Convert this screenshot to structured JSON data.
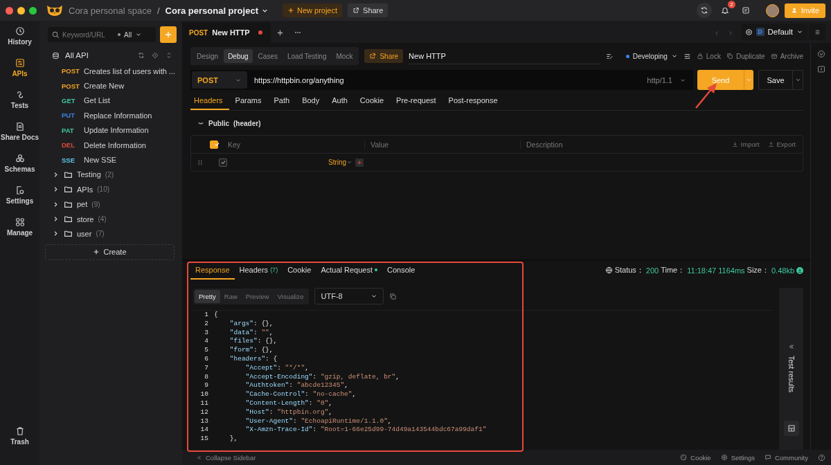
{
  "topbar": {
    "workspace": "Cora personal space",
    "separator": "/",
    "project": "Cora personal project",
    "new_project": "New project",
    "share": "Share",
    "notifications": "2",
    "invite": "Invite"
  },
  "rail": [
    {
      "label": "History",
      "selected": false
    },
    {
      "label": "APIs",
      "selected": true
    },
    {
      "label": "Tests",
      "selected": false
    },
    {
      "label": "Share Docs",
      "selected": false
    },
    {
      "label": "Schemas",
      "selected": false
    },
    {
      "label": "Settings",
      "selected": false
    },
    {
      "label": "Manage",
      "selected": false
    }
  ],
  "rail_bottom": "Trash",
  "sidebar": {
    "search_placeholder": "Keyword/URL",
    "filter": "All",
    "root": "All API",
    "apis": [
      {
        "method": "POST",
        "name": "Creates list of users with ...",
        "color": "#f5a623"
      },
      {
        "method": "POST",
        "name": "Create New",
        "color": "#f5a623"
      },
      {
        "method": "GET",
        "name": "Get List",
        "color": "#3ec9a0"
      },
      {
        "method": "PUT",
        "name": "Replace Information",
        "color": "#3a82e8"
      },
      {
        "method": "PAT",
        "name": "Update Information",
        "color": "#3ec9a0"
      },
      {
        "method": "DEL",
        "name": "Delete Information",
        "color": "#e5493a"
      },
      {
        "method": "SSE",
        "name": "New SSE",
        "color": "#5ec8e8"
      }
    ],
    "folders": [
      {
        "name": "Testing",
        "count": "(2)",
        "expanded": false
      },
      {
        "name": "APIs",
        "count": "(10)",
        "expanded": false
      },
      {
        "name": "pet",
        "count": "(9)",
        "expanded": false
      },
      {
        "name": "store",
        "count": "(4)",
        "expanded": false
      },
      {
        "name": "user",
        "count": "(7)",
        "expanded": false
      }
    ],
    "create": "Create"
  },
  "tab": {
    "method": "POST",
    "name": "New HTTP",
    "unsaved": true
  },
  "environment": {
    "badge": "D",
    "name": "Default"
  },
  "modes": [
    {
      "label": "Design",
      "selected": false
    },
    {
      "label": "Debug",
      "selected": true
    },
    {
      "label": "Cases",
      "selected": false
    },
    {
      "label": "Load Testing",
      "selected": false
    },
    {
      "label": "Mock",
      "selected": false
    }
  ],
  "api_share": "Share",
  "api_name": "New HTTP",
  "api_status": "Developing",
  "api_actions": [
    "Lock",
    "Duplicate",
    "Archive"
  ],
  "request": {
    "method": "POST",
    "url": "https://httpbin.org/anything",
    "protocol": "http/1.1",
    "send": "Send",
    "save": "Save"
  },
  "request_tabs": [
    {
      "label": "Headers",
      "selected": true
    },
    {
      "label": "Params",
      "selected": false
    },
    {
      "label": "Path",
      "selected": false
    },
    {
      "label": "Body",
      "selected": false
    },
    {
      "label": "Auth",
      "selected": false
    },
    {
      "label": "Cookie",
      "selected": false
    },
    {
      "label": "Pre-request",
      "selected": false
    },
    {
      "label": "Post-response",
      "selected": false
    }
  ],
  "public_group": {
    "label": "Public",
    "note": "(header)",
    "expanded": true
  },
  "params_table": {
    "columns": [
      "Key",
      "Value",
      "Description"
    ],
    "all_checked": true,
    "import": "Import",
    "export": "Export",
    "rows": [
      {
        "checked": true,
        "type": "String",
        "required": true
      }
    ]
  },
  "response_tabs": [
    {
      "label": "Response",
      "dot": false,
      "selected": true
    },
    {
      "label": "Headers",
      "count": "(7)",
      "dot": false,
      "selected": false
    },
    {
      "label": "Cookie",
      "dot": false,
      "selected": false
    },
    {
      "label": "Actual Request",
      "dot": true,
      "selected": false
    },
    {
      "label": "Console",
      "dot": false,
      "selected": false
    }
  ],
  "response_meta": {
    "status_label": "Status：",
    "status": "200",
    "time_label": "Time：",
    "time": "11:18:47",
    "duration": "1164ms",
    "size_label": "Size：",
    "size": "0.48kb"
  },
  "view_modes": [
    {
      "label": "Pretty",
      "selected": true
    },
    {
      "label": "Raw",
      "selected": false
    },
    {
      "label": "Preview",
      "selected": false
    },
    {
      "label": "Visualize",
      "selected": false
    }
  ],
  "encoding": "UTF-8",
  "code_lines": [
    {
      "number": "1",
      "tokens": [
        {
          "kind": "punct",
          "text": "{"
        }
      ]
    },
    {
      "number": "2",
      "tokens": [
        {
          "kind": "key",
          "text": "\"args\""
        },
        {
          "kind": "punct",
          "text": ": {},"
        }
      ]
    },
    {
      "number": "3",
      "tokens": [
        {
          "kind": "key",
          "text": "\"data\""
        },
        {
          "kind": "punct",
          "text": ": "
        },
        {
          "kind": "string",
          "text": "\"\""
        },
        {
          "kind": "punct",
          "text": ","
        }
      ]
    },
    {
      "number": "4",
      "tokens": [
        {
          "kind": "key",
          "text": "\"files\""
        },
        {
          "kind": "punct",
          "text": ": {},"
        }
      ]
    },
    {
      "number": "5",
      "tokens": [
        {
          "kind": "key",
          "text": "\"form\""
        },
        {
          "kind": "punct",
          "text": ": {},"
        }
      ]
    },
    {
      "number": "6",
      "tokens": [
        {
          "kind": "key",
          "text": "\"headers\""
        },
        {
          "kind": "punct",
          "text": ": {"
        }
      ]
    },
    {
      "number": "7",
      "tokens": [
        {
          "kind": "key",
          "text": "\"Accept\""
        },
        {
          "kind": "punct",
          "text": ": "
        },
        {
          "kind": "string",
          "text": "\"*/*\""
        },
        {
          "kind": "punct",
          "text": ","
        }
      ]
    },
    {
      "number": "8",
      "tokens": [
        {
          "kind": "key",
          "text": "\"Accept-Encoding\""
        },
        {
          "kind": "punct",
          "text": ": "
        },
        {
          "kind": "string",
          "text": "\"gzip, deflate, br\""
        },
        {
          "kind": "punct",
          "text": ","
        }
      ]
    },
    {
      "number": "9",
      "tokens": [
        {
          "kind": "key",
          "text": "\"Authtoken\""
        },
        {
          "kind": "punct",
          "text": ": "
        },
        {
          "kind": "string",
          "text": "\"abcde12345\""
        },
        {
          "kind": "punct",
          "text": ","
        }
      ]
    },
    {
      "number": "10",
      "tokens": [
        {
          "kind": "key",
          "text": "\"Cache-Control\""
        },
        {
          "kind": "punct",
          "text": ": "
        },
        {
          "kind": "string",
          "text": "\"no-cache\""
        },
        {
          "kind": "punct",
          "text": ","
        }
      ]
    },
    {
      "number": "11",
      "tokens": [
        {
          "kind": "key",
          "text": "\"Content-Length\""
        },
        {
          "kind": "punct",
          "text": ": "
        },
        {
          "kind": "string",
          "text": "\"0\""
        },
        {
          "kind": "punct",
          "text": ","
        }
      ]
    },
    {
      "number": "12",
      "tokens": [
        {
          "kind": "key",
          "text": "\"Host\""
        },
        {
          "kind": "punct",
          "text": ": "
        },
        {
          "kind": "string",
          "text": "\"httpbin.org\""
        },
        {
          "kind": "punct",
          "text": ","
        }
      ]
    },
    {
      "number": "13",
      "tokens": [
        {
          "kind": "key",
          "text": "\"User-Agent\""
        },
        {
          "kind": "punct",
          "text": ": "
        },
        {
          "kind": "string",
          "text": "\"EchoapiRuntime/1.1.0\""
        },
        {
          "kind": "punct",
          "text": ","
        }
      ]
    },
    {
      "number": "14",
      "tokens": [
        {
          "kind": "key",
          "text": "\"X-Amzn-Trace-Id\""
        },
        {
          "kind": "punct",
          "text": ": "
        },
        {
          "kind": "string",
          "text": "\"Root=1-66e25d99-74d49a143544bdc67a99daf1\""
        }
      ]
    },
    {
      "number": "15",
      "tokens": [
        {
          "kind": "punct",
          "text": "},"
        }
      ]
    }
  ],
  "test_results": "Test results",
  "footer": {
    "collapse": "Collapse Sidebar",
    "links": [
      "Cookie",
      "Settings",
      "Community"
    ]
  }
}
